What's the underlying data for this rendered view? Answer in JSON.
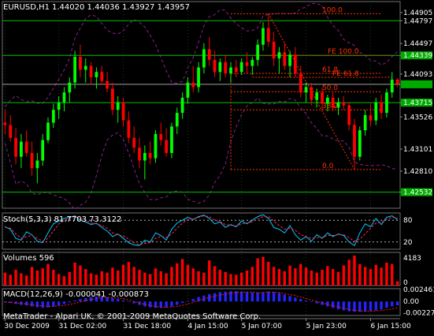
{
  "colors": {
    "background": "#000000",
    "up_candle": "#00ff00",
    "down_candle": "#ff0000",
    "text": "#ffffff",
    "grid": "#1c3a1c",
    "green_line": "#00c000",
    "fib": "#ff3300",
    "bands": "#8b1f8b",
    "stoch_main": "#00ccff",
    "stoch_signal": "#ff2255",
    "volume": "#ff0000",
    "macd_hist": "#2424ff",
    "macd_signal": "#ff1a1a",
    "price_tag_bg": "#00aa00"
  },
  "chart_data": [
    {
      "type": "candlestick",
      "title": "EURUSD,H1",
      "ohlc_label": "1.44020 1.44036 1.43927 1.43957",
      "y_ticks": [
        "1.44905",
        "1.44797",
        "1.44497",
        "1.44339",
        "1.44093",
        "1.43715",
        "1.43526",
        "1.43101",
        "1.42810",
        "1.42532"
      ],
      "ylim": [
        1.4232,
        1.4505
      ],
      "horizontal_levels": [
        1.44797,
        1.44339,
        1.43715,
        1.42532
      ],
      "last_price_line": 1.43957,
      "fib_retracement": {
        "high": 1.4489,
        "low": 1.4283,
        "levels": [
          {
            "label": "100.0",
            "price": 1.4489
          },
          {
            "label": "61.8",
            "price": 1.441
          },
          {
            "label": "50.0",
            "price": 1.4386
          },
          {
            "label": "38.2",
            "price": 1.4362
          },
          {
            "label": "0.0",
            "price": 1.4283
          }
        ]
      },
      "fib_expansion": [
        {
          "label": "FE 100.0",
          "price": 1.44339
        },
        {
          "label": "FE 61.8",
          "price": 1.4405
        }
      ],
      "candles": [
        [
          1.4345,
          1.4362,
          1.433,
          1.4342
        ],
        [
          1.4342,
          1.4355,
          1.432,
          1.4325
        ],
        [
          1.4325,
          1.4338,
          1.429,
          1.43
        ],
        [
          1.43,
          1.433,
          1.4285,
          1.432
        ],
        [
          1.432,
          1.4335,
          1.43,
          1.4305
        ],
        [
          1.4305,
          1.432,
          1.4275,
          1.4285
        ],
        [
          1.4285,
          1.4305,
          1.4265,
          1.4295
        ],
        [
          1.4295,
          1.433,
          1.4288,
          1.4322
        ],
        [
          1.4322,
          1.4352,
          1.4318,
          1.4345
        ],
        [
          1.4345,
          1.437,
          1.4338,
          1.4362
        ],
        [
          1.4362,
          1.438,
          1.435,
          1.4372
        ],
        [
          1.4372,
          1.4392,
          1.436,
          1.4385
        ],
        [
          1.4385,
          1.4405,
          1.4372,
          1.4398
        ],
        [
          1.4398,
          1.444,
          1.439,
          1.4432
        ],
        [
          1.4432,
          1.4448,
          1.4405,
          1.4415
        ],
        [
          1.4415,
          1.443,
          1.4398,
          1.442
        ],
        [
          1.442,
          1.4425,
          1.4395,
          1.4405
        ],
        [
          1.4405,
          1.4418,
          1.439,
          1.4412
        ],
        [
          1.4412,
          1.442,
          1.4395,
          1.44
        ],
        [
          1.44,
          1.4412,
          1.4385,
          1.439
        ],
        [
          1.439,
          1.4398,
          1.4355,
          1.4362
        ],
        [
          1.4362,
          1.438,
          1.4345,
          1.4372
        ],
        [
          1.4372,
          1.4378,
          1.434,
          1.4348
        ],
        [
          1.4348,
          1.436,
          1.4318,
          1.4325
        ],
        [
          1.4325,
          1.434,
          1.4305,
          1.4312
        ],
        [
          1.4312,
          1.4325,
          1.4285,
          1.4295
        ],
        [
          1.4295,
          1.4315,
          1.427,
          1.4305
        ],
        [
          1.4305,
          1.432,
          1.429,
          1.4298
        ],
        [
          1.4298,
          1.4335,
          1.4292,
          1.433
        ],
        [
          1.433,
          1.4345,
          1.4315,
          1.4322
        ],
        [
          1.4322,
          1.4338,
          1.43,
          1.4305
        ],
        [
          1.4305,
          1.4345,
          1.4298,
          1.434
        ],
        [
          1.434,
          1.4365,
          1.433,
          1.4358
        ],
        [
          1.4358,
          1.4385,
          1.435,
          1.4378
        ],
        [
          1.4378,
          1.4405,
          1.437,
          1.4398
        ],
        [
          1.4398,
          1.442,
          1.4385,
          1.4392
        ],
        [
          1.4392,
          1.4425,
          1.4385,
          1.4418
        ],
        [
          1.4418,
          1.445,
          1.441,
          1.4442
        ],
        [
          1.4442,
          1.4458,
          1.442,
          1.4428
        ],
        [
          1.4428,
          1.444,
          1.4405,
          1.4412
        ],
        [
          1.4412,
          1.443,
          1.44,
          1.4425
        ],
        [
          1.4425,
          1.4435,
          1.4405,
          1.441
        ],
        [
          1.441,
          1.4425,
          1.4398,
          1.4418
        ],
        [
          1.4418,
          1.4428,
          1.4405,
          1.4412
        ],
        [
          1.4412,
          1.443,
          1.4408,
          1.4425
        ],
        [
          1.4425,
          1.4438,
          1.441,
          1.442
        ],
        [
          1.442,
          1.4432,
          1.4408,
          1.4428
        ],
        [
          1.4428,
          1.4455,
          1.442,
          1.4448
        ],
        [
          1.4448,
          1.4478,
          1.444,
          1.447
        ],
        [
          1.447,
          1.4489,
          1.4445,
          1.4452
        ],
        [
          1.4452,
          1.4465,
          1.442,
          1.443
        ],
        [
          1.443,
          1.4445,
          1.441,
          1.4438
        ],
        [
          1.4438,
          1.445,
          1.4415,
          1.442
        ],
        [
          1.442,
          1.444,
          1.4405,
          1.4435
        ],
        [
          1.4435,
          1.4445,
          1.4405,
          1.441
        ],
        [
          1.441,
          1.442,
          1.4378,
          1.4385
        ],
        [
          1.4385,
          1.4398,
          1.4372,
          1.4392
        ],
        [
          1.4392,
          1.4398,
          1.4368,
          1.4375
        ],
        [
          1.4375,
          1.439,
          1.4365,
          1.4385
        ],
        [
          1.4385,
          1.4392,
          1.4362,
          1.437
        ],
        [
          1.437,
          1.4382,
          1.436,
          1.4378
        ],
        [
          1.4378,
          1.4385,
          1.436,
          1.4365
        ],
        [
          1.4365,
          1.4378,
          1.4355,
          1.4372
        ],
        [
          1.4372,
          1.438,
          1.4362,
          1.4368
        ],
        [
          1.4368,
          1.4372,
          1.4335,
          1.4342
        ],
        [
          1.4342,
          1.435,
          1.4283,
          1.43
        ],
        [
          1.43,
          1.434,
          1.4295,
          1.4335
        ],
        [
          1.4335,
          1.4362,
          1.4328,
          1.4355
        ],
        [
          1.4355,
          1.437,
          1.434,
          1.4348
        ],
        [
          1.4348,
          1.4378,
          1.4342,
          1.4372
        ],
        [
          1.4372,
          1.4382,
          1.435,
          1.4358
        ],
        [
          1.4358,
          1.439,
          1.4352,
          1.4385
        ],
        [
          1.4385,
          1.4412,
          1.4378,
          1.4402
        ],
        [
          1.4402,
          1.4404,
          1.4392,
          1.4396
        ]
      ]
    },
    {
      "type": "line",
      "title": "Stoch(5,3,3) 81.7703 73.3122",
      "ylim": [
        0,
        100
      ],
      "y_ticks": [
        "80",
        "20"
      ],
      "levels": [
        80,
        20
      ],
      "series": [
        {
          "name": "main",
          "values": [
            62,
            55,
            30,
            25,
            48,
            40,
            22,
            18,
            45,
            70,
            78,
            85,
            88,
            92,
            80,
            75,
            68,
            72,
            60,
            50,
            35,
            42,
            30,
            18,
            12,
            10,
            25,
            20,
            45,
            38,
            25,
            55,
            72,
            80,
            88,
            82,
            90,
            94,
            85,
            70,
            75,
            60,
            68,
            62,
            78,
            70,
            80,
            90,
            95,
            85,
            60,
            55,
            45,
            65,
            40,
            25,
            35,
            22,
            40,
            30,
            45,
            35,
            42,
            38,
            20,
            10,
            45,
            70,
            62,
            85,
            68,
            88,
            92,
            82
          ]
        },
        {
          "name": "signal",
          "values": [
            60,
            58,
            42,
            30,
            35,
            38,
            30,
            22,
            30,
            50,
            70,
            80,
            85,
            88,
            86,
            80,
            72,
            70,
            65,
            58,
            45,
            40,
            36,
            28,
            18,
            12,
            16,
            18,
            30,
            36,
            32,
            42,
            58,
            72,
            82,
            84,
            88,
            92,
            90,
            80,
            76,
            68,
            66,
            64,
            70,
            72,
            76,
            84,
            90,
            90,
            78,
            65,
            55,
            58,
            52,
            40,
            35,
            30,
            32,
            32,
            38,
            38,
            40,
            40,
            32,
            22,
            28,
            42,
            58,
            72,
            74,
            82,
            88,
            86
          ]
        }
      ]
    },
    {
      "type": "bar",
      "title": "Volumes 596",
      "y_ticks": [
        "4183",
        "0"
      ],
      "ylim": [
        0,
        4183
      ],
      "values": [
        1800,
        1500,
        2200,
        1700,
        1400,
        2600,
        2100,
        2400,
        3000,
        2200,
        1600,
        1300,
        1900,
        3200,
        2800,
        2300,
        1700,
        1500,
        2000,
        1800,
        2500,
        2100,
        2900,
        3300,
        2600,
        2200,
        1800,
        1600,
        2400,
        2000,
        1700,
        2600,
        3100,
        3700,
        2900,
        2400,
        2000,
        1800,
        3500,
        2700,
        2200,
        1900,
        1600,
        1500,
        1800,
        2100,
        2600,
        3800,
        4000,
        3300,
        2600,
        2300,
        2000,
        2800,
        2400,
        3000,
        2500,
        2100,
        1800,
        2200,
        2700,
        2300,
        1900,
        2800,
        3600,
        4183,
        3000,
        2600,
        2300,
        2900,
        2500,
        3200,
        3000,
        596
      ]
    },
    {
      "type": "bar",
      "title": "MACD(12,26,9) -0.000041 -0.000873",
      "y_ticks": [
        "0.002461",
        "0.00",
        "-0.002275"
      ],
      "ylim": [
        -0.00285,
        0.0026
      ],
      "values": [
        -0.0002,
        -0.0003,
        -0.0005,
        -0.0007,
        -0.0008,
        -0.001,
        -0.0012,
        -0.0013,
        -0.0012,
        -0.001,
        -0.0008,
        -0.0005,
        -0.0002,
        0.0002,
        0.0005,
        0.0007,
        0.0009,
        0.001,
        0.001,
        0.0009,
        0.0007,
        0.0005,
        0.0002,
        -0.0001,
        -0.0004,
        -0.0007,
        -0.001,
        -0.0012,
        -0.0013,
        -0.0013,
        -0.0012,
        -0.001,
        -0.0007,
        -0.0003,
        0.0001,
        0.0005,
        0.0009,
        0.0012,
        0.0015,
        0.0017,
        0.0019,
        0.002,
        0.0021,
        0.0021,
        0.002,
        0.0019,
        0.0018,
        0.0018,
        0.0019,
        0.002,
        0.0019,
        0.0017,
        0.0014,
        0.0011,
        0.0008,
        0.0005,
        0.0002,
        -0.0001,
        -0.0004,
        -0.0007,
        -0.001,
        -0.0013,
        -0.0016,
        -0.0018,
        -0.002,
        -0.0021,
        -0.0021,
        -0.002,
        -0.0019,
        -0.0018,
        -0.0016,
        -0.0013,
        -0.001,
        -0.0008
      ],
      "signal": [
        -0.0001,
        -0.0002,
        -0.0003,
        -0.0004,
        -0.0005,
        -0.0007,
        -0.0008,
        -0.0009,
        -0.001,
        -0.001,
        -0.0009,
        -0.0008,
        -0.0006,
        -0.0004,
        -0.0001,
        0.0002,
        0.0004,
        0.0006,
        0.0008,
        0.0008,
        0.0008,
        0.0007,
        0.0005,
        0.0003,
        0.0,
        -0.0003,
        -0.0006,
        -0.0008,
        -0.001,
        -0.0011,
        -0.0012,
        -0.0011,
        -0.001,
        -0.0008,
        -0.0005,
        -0.0002,
        0.0002,
        0.0005,
        0.0008,
        0.0011,
        0.0013,
        0.0015,
        0.0017,
        0.0018,
        0.0019,
        0.0019,
        0.0019,
        0.0018,
        0.0018,
        0.0019,
        0.0019,
        0.0018,
        0.0016,
        0.0014,
        0.0012,
        0.0009,
        0.0006,
        0.0003,
        0.0,
        -0.0003,
        -0.0006,
        -0.0009,
        -0.0011,
        -0.0014,
        -0.0016,
        -0.0018,
        -0.0019,
        -0.002,
        -0.002,
        -0.0019,
        -0.0018,
        -0.0017,
        -0.0015,
        -0.0013
      ]
    }
  ],
  "x_ticks": [
    "30 Dec 2009",
    "31 Dec 02:00",
    "31 Dec 18:00",
    "4 Jan 15:00",
    "5 Jan 07:00",
    "5 Jan 23:00",
    "6 Jan 15:00"
  ],
  "copyright": "MetaTrader - Alpari UK, © 2001-2009 MetaQuotes Software Corp."
}
